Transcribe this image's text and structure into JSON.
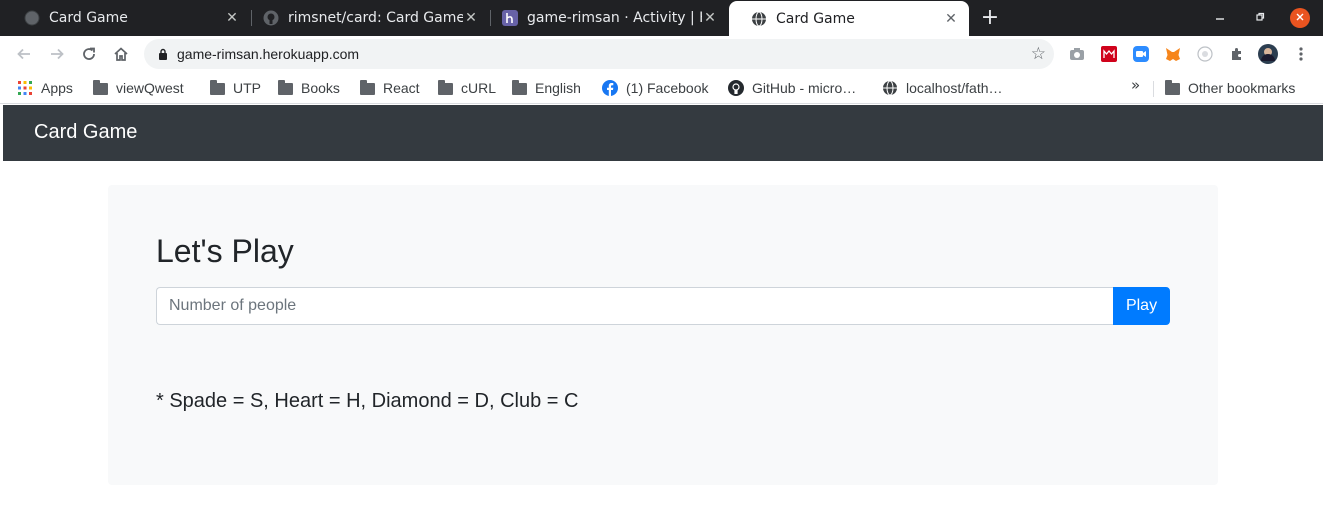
{
  "browser": {
    "tabs": [
      {
        "title": "Card Game",
        "favicon": "globe-icon",
        "active": false
      },
      {
        "title": "rimsnet/card: Card Game",
        "favicon": "github-icon",
        "active": false
      },
      {
        "title": "game-rimsan · Activity | H",
        "favicon": "heroku-icon",
        "active": false
      },
      {
        "title": "Card Game",
        "favicon": "globe-icon",
        "active": true
      }
    ],
    "new_tab_glyph": "+",
    "close_glyph": "✕",
    "address": "game-rimsan.herokuapp.com",
    "bookmarks": [
      {
        "label": "Apps",
        "icon": "apps-grid-icon"
      },
      {
        "label": "viewQwest",
        "icon": "folder-icon"
      },
      {
        "label": "UTP",
        "icon": "folder-icon"
      },
      {
        "label": "Books",
        "icon": "folder-icon"
      },
      {
        "label": "React",
        "icon": "folder-icon"
      },
      {
        "label": "cURL",
        "icon": "folder-icon"
      },
      {
        "label": "English",
        "icon": "folder-icon"
      },
      {
        "label": "(1) Facebook",
        "icon": "facebook-icon"
      },
      {
        "label": "GitHub - micro…",
        "icon": "github-icon"
      },
      {
        "label": "localhost/fath…",
        "icon": "globe-icon"
      }
    ],
    "bookmarks_overflow": "»",
    "other_bookmarks": "Other bookmarks",
    "colors": {
      "chrome_dark": "#202124",
      "close_button": "#e95420"
    }
  },
  "page": {
    "navbar": {
      "brand": "Card Game"
    },
    "heading": "Let's Play",
    "input": {
      "placeholder": "Number of people",
      "value": ""
    },
    "play_button": "Play",
    "legend": "* Spade = S, Heart = H, Diamond = D, Club = C",
    "colors": {
      "navbar": "#343a40",
      "primary": "#007bff",
      "jumbotron": "#f8f9fa"
    }
  }
}
